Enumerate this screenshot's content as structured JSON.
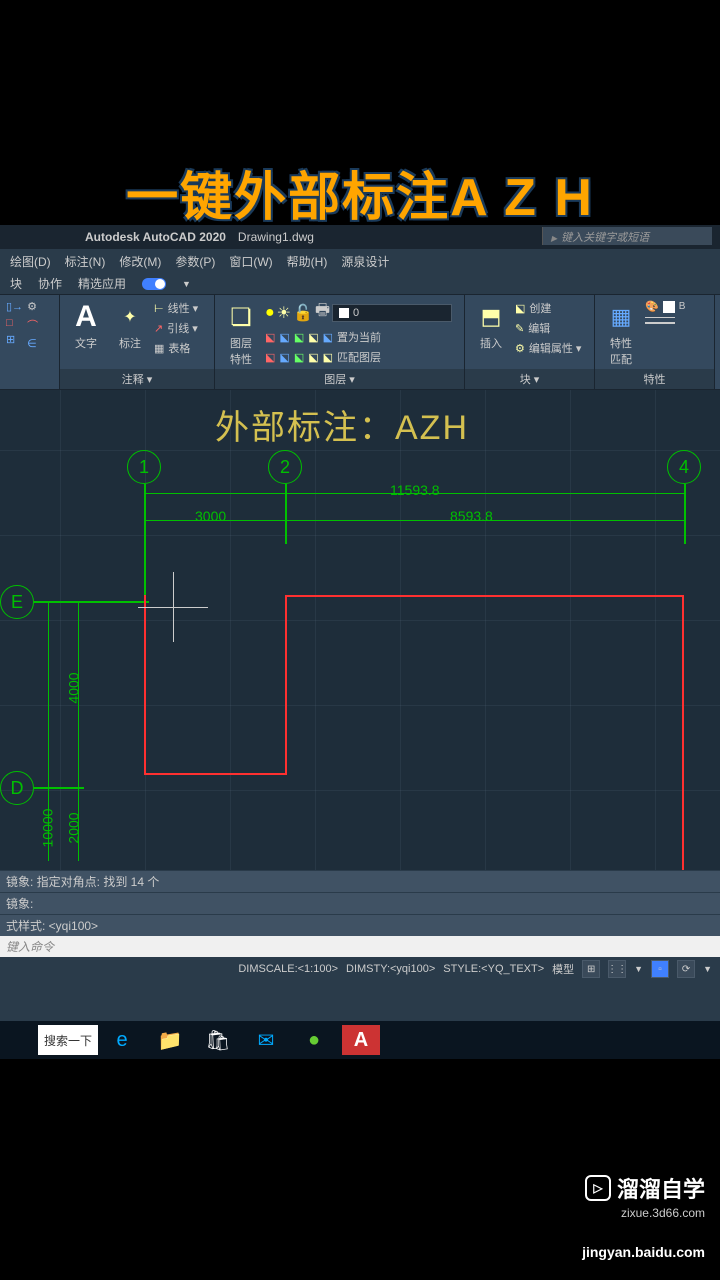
{
  "video_title": "一键外部标注A Z H",
  "titlebar": {
    "app": "Autodesk AutoCAD 2020",
    "doc": "Drawing1.dwg",
    "search_placeholder": "键入关键字或短语"
  },
  "menubar": [
    "绘图(D)",
    "标注(N)",
    "修改(M)",
    "参数(P)",
    "窗口(W)",
    "帮助(H)",
    "源泉设计"
  ],
  "tabbar": [
    "块",
    "协作",
    "精选应用"
  ],
  "ribbon": {
    "annotate": {
      "label": "注释 ▾",
      "text_btn": "文字",
      "dim_btn": "标注",
      "line_items": [
        "线性 ▾",
        "引线 ▾",
        "表格"
      ]
    },
    "layers": {
      "label": "图层 ▾",
      "props_btn": "图层\n特性",
      "current": "0",
      "make_current": "置为当前",
      "match": "匹配图层"
    },
    "blocks": {
      "label": "块 ▾",
      "insert_btn": "插入",
      "create": "创建",
      "edit": "编辑",
      "edit_attrs": "编辑属性 ▾"
    },
    "props": {
      "label": "特性",
      "props_btn": "特性",
      "match_btn": "特性\n匹配"
    }
  },
  "drawing": {
    "overlay_text": "外部标注：AZH",
    "bubbles": {
      "1": "1",
      "2": "2",
      "4": "4",
      "E": "E",
      "D": "D"
    },
    "dims": {
      "d1": "3000",
      "d2": "8593.8",
      "d3": "11593.8",
      "v1": "4000",
      "v2": "2000",
      "v3": "10000"
    }
  },
  "cmd": {
    "line1": "镜象: 指定对角点: 找到 14 个",
    "line2": "镜象:",
    "line3": "式样式: <yqi100>",
    "input_placeholder": "键入命令"
  },
  "statusbar": {
    "dimscale": "DIMSCALE:<1:100>",
    "dimsty": "DIMSTY:<yqi100>",
    "style": "STYLE:<YQ_TEXT>",
    "model": "模型"
  },
  "taskbar": {
    "search": "搜索一下"
  },
  "watermark": {
    "brand": "溜溜自学",
    "url": "zixue.3d66.com",
    "source": "jingyan.baidu.com"
  }
}
